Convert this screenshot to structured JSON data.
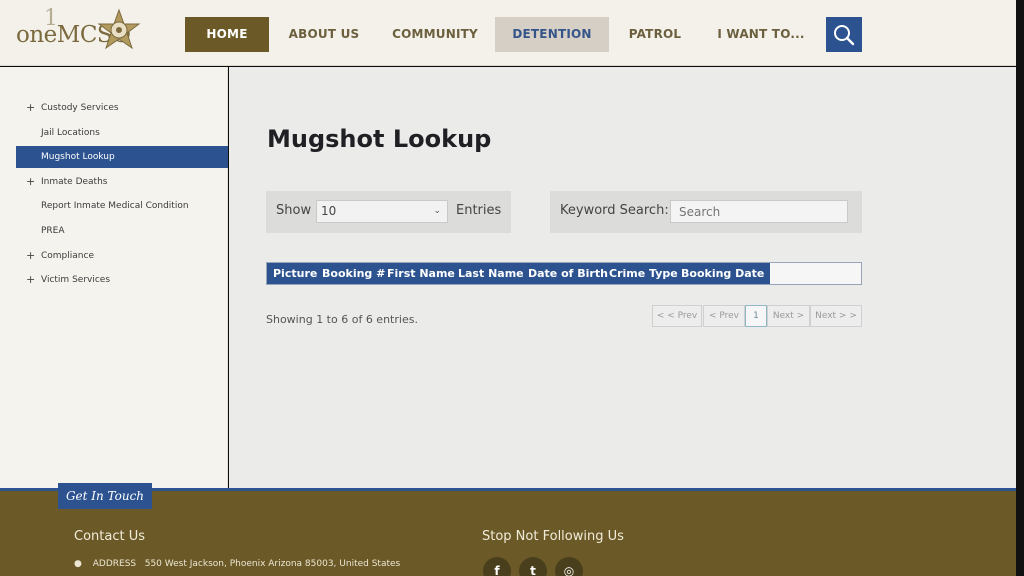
{
  "header": {
    "logo_text": "oneMCSO",
    "logo_mark": "1",
    "nav": [
      {
        "label": "HOME"
      },
      {
        "label": "ABOUT US"
      },
      {
        "label": "COMMUNITY"
      },
      {
        "label": "DETENTION"
      },
      {
        "label": "PATROL"
      },
      {
        "label": "I WANT TO..."
      }
    ],
    "search_icon": "search-icon"
  },
  "sidebar": {
    "items": [
      {
        "label": "Custody Services",
        "expandable": true
      },
      {
        "label": "Jail Locations",
        "expandable": false
      },
      {
        "label": "Mugshot Lookup",
        "expandable": false,
        "active": true
      },
      {
        "label": "Inmate Deaths",
        "expandable": true
      },
      {
        "label": "Report Inmate Medical Condition",
        "expandable": false
      },
      {
        "label": "PREA",
        "expandable": false
      },
      {
        "label": "Compliance",
        "expandable": true
      },
      {
        "label": "Victim Services",
        "expandable": true
      }
    ],
    "plus": "+"
  },
  "main": {
    "title": "Mugshot Lookup",
    "show_label": "Show",
    "show_value": "10",
    "entries_label": "Entries",
    "keyword_label": "Keyword Search:",
    "search_placeholder": "Search",
    "columns": [
      "Picture",
      "Booking #",
      "First Name",
      "Last Name",
      "Date of Birth",
      "Crime Type",
      "Booking Date"
    ],
    "showing_text": "Showing 1 to 6 of 6 entries.",
    "pager": {
      "first": "< < Prev",
      "prev": "< Prev",
      "current": "1",
      "next": "Next >",
      "last": "Next > >"
    }
  },
  "footer": {
    "tab_label": "Get In Touch",
    "contact_title": "Contact Us",
    "address_label": "ADDRESS",
    "address_value": "550 West Jackson, Phoenix Arizona 85003, United States",
    "follow_title": "Stop Not Following Us",
    "social": [
      {
        "icon": "facebook-icon",
        "glyph": "f"
      },
      {
        "icon": "twitter-icon",
        "glyph": "t"
      },
      {
        "icon": "instagram-icon",
        "glyph": "◎"
      }
    ]
  },
  "colors": {
    "brand_blue": "#2c5390",
    "brand_olive": "#6b5a28",
    "detention_bg": "#d6cfc6"
  }
}
